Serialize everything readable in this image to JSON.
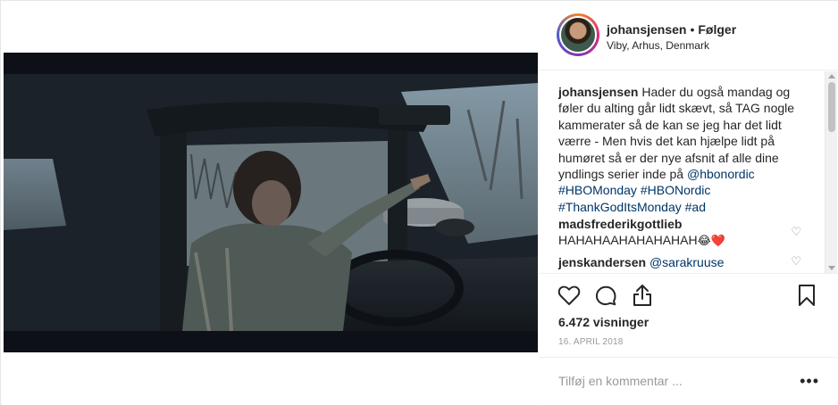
{
  "header": {
    "username": "johansjensen",
    "separator": "•",
    "follow_label": "Følger",
    "location": "Viby, Arhus, Denmark"
  },
  "caption": {
    "username": "johansjensen",
    "text": "Hader du også mandag og føler du alting går lidt skævt, så TAG nogle kammerater så de kan se jeg har det lidt værre - Men hvis det kan hjælpe lidt på humøret så er der nye afsnit af alle dine yndlings serier inde på",
    "mention": "@hbonordic",
    "hashtags": [
      "#HBOMonday",
      "#HBONordic",
      "#ThankGodItsMonday",
      "#ad"
    ]
  },
  "comments": [
    {
      "username": "madsfrederikgottlieb",
      "text": "HAHAHAAHAHAHAHAH",
      "emoji": "😂❤️"
    },
    {
      "username": "jenskandersen",
      "text": "@sarakruuse"
    }
  ],
  "actions": {
    "like_icon": "heart-icon",
    "comment_icon": "comment-icon",
    "share_icon": "share-icon",
    "save_icon": "bookmark-icon"
  },
  "views": "6.472 visninger",
  "date": "16. APRIL 2018",
  "add_comment_placeholder": "Tilføj en kommentar ...",
  "more_label": "•••"
}
